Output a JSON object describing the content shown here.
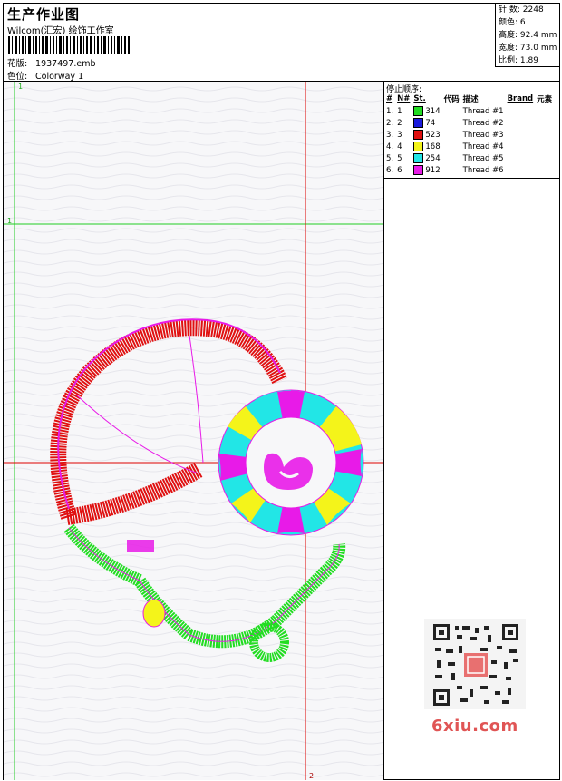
{
  "header": {
    "title": "生产作业图",
    "company": "Wilcom(汇宏) 绘饰工作室",
    "file_label": "花版:",
    "file_value": "1937497.emb",
    "colorway_label": "色位:",
    "colorway_value": "Colorway 1"
  },
  "stats": [
    {
      "label": "针 数:",
      "value": "2248"
    },
    {
      "label": "颜色:",
      "value": "6"
    },
    {
      "label": "高度:",
      "value": "92.4 mm"
    },
    {
      "label": "宽度:",
      "value": "73.0 mm"
    },
    {
      "label": "比例:",
      "value": "1.89"
    }
  ],
  "stop_sequence": {
    "title": "停止顺序:",
    "headers": [
      "#",
      "N#",
      "St.",
      "代码",
      "描述",
      "Brand",
      "元素"
    ],
    "rows": [
      {
        "n": "1.",
        "nn": "1",
        "color": "#22dd22",
        "st": "314",
        "desc": "Thread #1"
      },
      {
        "n": "2.",
        "nn": "2",
        "color": "#1a1adc",
        "st": "74",
        "desc": "Thread #2"
      },
      {
        "n": "3.",
        "nn": "3",
        "color": "#e01010",
        "st": "523",
        "desc": "Thread #3"
      },
      {
        "n": "4.",
        "nn": "4",
        "color": "#f4f41a",
        "st": "168",
        "desc": "Thread #4"
      },
      {
        "n": "5.",
        "nn": "5",
        "color": "#22e6e6",
        "st": "254",
        "desc": "Thread #5"
      },
      {
        "n": "6.",
        "nn": "6",
        "color": "#e81ae8",
        "st": "912",
        "desc": "Thread #6"
      }
    ]
  },
  "canvas": {
    "guide_labels": {
      "top": "1",
      "left": "1",
      "bottom": "2"
    }
  },
  "watermark": {
    "text": "6xiu.com"
  },
  "colors": {
    "green": "#22dd22",
    "red": "#e01010",
    "magenta": "#e81ae8",
    "cyan": "#22e6e6",
    "yellow": "#f4f41a",
    "guide_green": "#22cc22",
    "guide_red": "#dd0000"
  }
}
